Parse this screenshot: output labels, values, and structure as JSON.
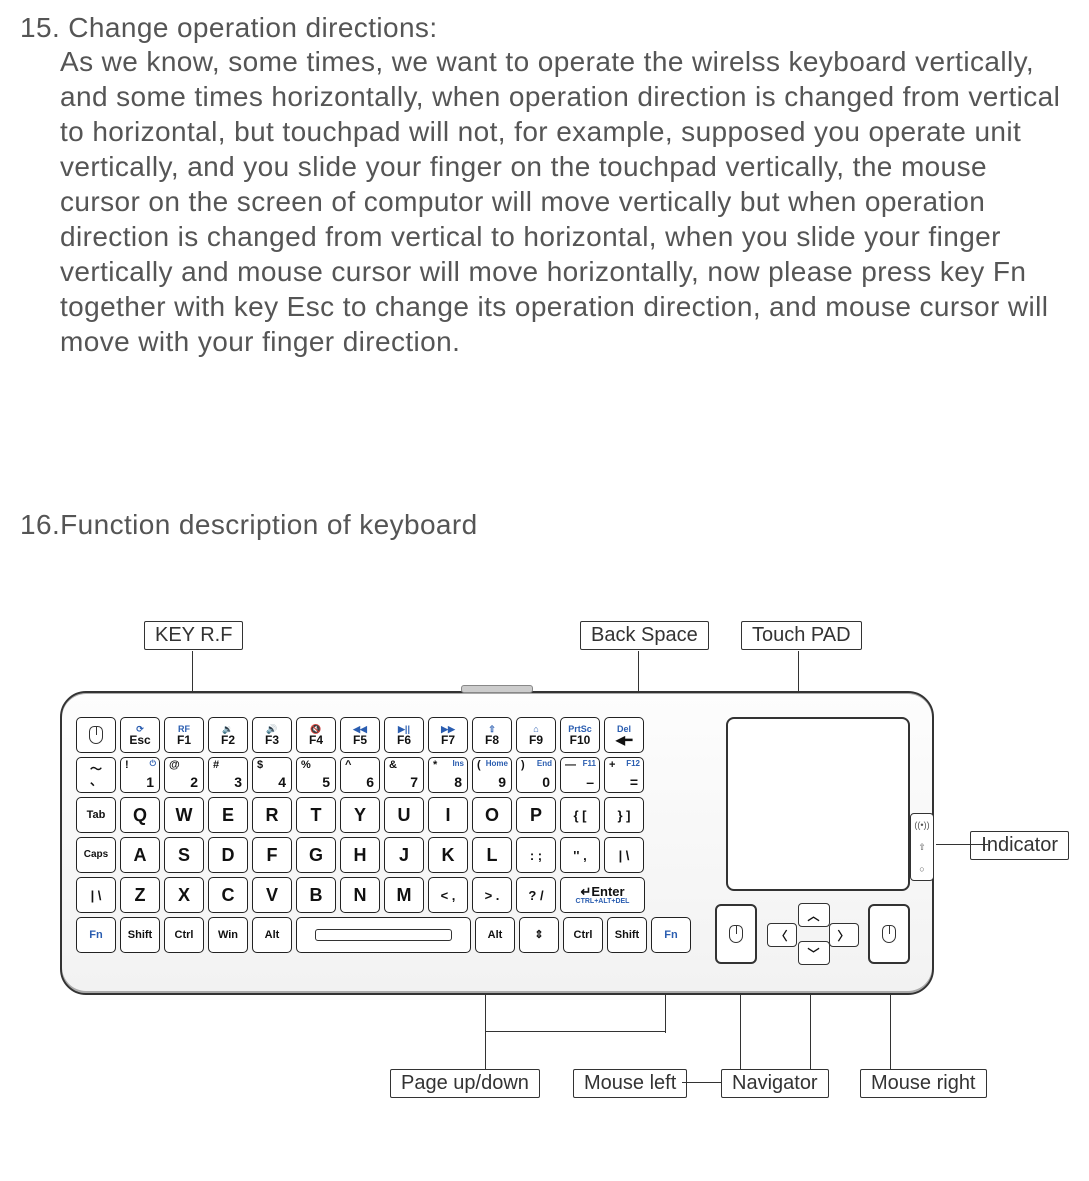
{
  "section15": {
    "title": "15. Change operation directions:",
    "body": "As we know, some times, we want to operate the wirelss keyboard vertically, and some times horizontally, when operation direction is changed from vertical to horizontal, but touchpad will not,  for example, supposed you operate unit vertically, and you slide your finger on the touchpad vertically, the mouse cursor on the screen of  computor will move vertically but when operation direction is changed from vertical to horizontal, when you slide your finger vertically and mouse cursor will move horizontally, now please press key Fn together with key Esc to change its operation direction, and mouse cursor will move with your finger direction."
  },
  "section16": {
    "title": "16.Function description of keyboard"
  },
  "callouts": {
    "key_rf": "KEY R.F",
    "back_space": "Back Space",
    "touch_pad": "Touch PAD",
    "indicator": "Indicator",
    "page_updown": "Page up/down",
    "mouse_left": "Mouse left",
    "navigator": "Navigator",
    "mouse_right": "Mouse right"
  },
  "keys": {
    "row1": [
      {
        "main": "",
        "sec": "",
        "icon": "mouse"
      },
      {
        "main": "Esc",
        "sec": "⟳"
      },
      {
        "main": "F1",
        "sec": "RF"
      },
      {
        "main": "F2",
        "sec": "🔉"
      },
      {
        "main": "F3",
        "sec": "🔊"
      },
      {
        "main": "F4",
        "sec": "🔇"
      },
      {
        "main": "F5",
        "sec": "◀◀"
      },
      {
        "main": "F6",
        "sec": "▶||"
      },
      {
        "main": "F7",
        "sec": "▶▶"
      },
      {
        "main": "F8",
        "sec": "⇧"
      },
      {
        "main": "F9",
        "sec": "⌂"
      },
      {
        "main": "F10",
        "sec": "PrtSc"
      },
      {
        "main": "◀━",
        "sec": "Del"
      }
    ],
    "row2": [
      {
        "type": "dual",
        "top": "～",
        "bot": "、"
      },
      {
        "type": "num",
        "sym": "!",
        "fn": "⏻",
        "n": "1"
      },
      {
        "type": "num",
        "sym": "@",
        "fn": "",
        "n": "2"
      },
      {
        "type": "num",
        "sym": "#",
        "fn": "",
        "n": "3"
      },
      {
        "type": "num",
        "sym": "$",
        "fn": "",
        "n": "4"
      },
      {
        "type": "num",
        "sym": "%",
        "fn": "",
        "n": "5"
      },
      {
        "type": "num",
        "sym": "^",
        "fn": "",
        "n": "6"
      },
      {
        "type": "num",
        "sym": "&",
        "fn": "",
        "n": "7"
      },
      {
        "type": "num",
        "sym": "*",
        "fn": "Ins",
        "n": "8"
      },
      {
        "type": "num",
        "sym": "(",
        "fn": "Home",
        "n": "9"
      },
      {
        "type": "num",
        "sym": ")",
        "fn": "End",
        "n": "0"
      },
      {
        "type": "num",
        "sym": "—",
        "fn": "F11",
        "n": "–"
      },
      {
        "type": "num",
        "sym": "+",
        "fn": "F12",
        "n": "="
      }
    ],
    "row3": [
      "Tab",
      "Q",
      "W",
      "E",
      "R",
      "T",
      "Y",
      "U",
      "I",
      "O",
      "P",
      "{ [",
      "} ]"
    ],
    "row4": [
      "Caps",
      "A",
      "S",
      "D",
      "F",
      "G",
      "H",
      "J",
      "K",
      "L",
      ": ;",
      "'' ,",
      "| \\"
    ],
    "row5_left": [
      "| \\",
      "Z",
      "X",
      "C",
      "V",
      "B",
      "N",
      "M",
      "< ,",
      "> .",
      "? /"
    ],
    "row5_enter_main": "↵Enter",
    "row5_enter_sec": "CTRL+ALT+DEL",
    "row6": [
      "Fn",
      "Shift",
      "Ctrl",
      "Win",
      "Alt",
      "",
      "Alt",
      "⇕",
      "Ctrl",
      "Shift",
      "Fn"
    ]
  },
  "indicator_icons": [
    "((•))",
    "⇧",
    "○"
  ],
  "nav_arrows": {
    "up": "︿",
    "down": "﹀",
    "left": "〈",
    "right": "〉"
  }
}
